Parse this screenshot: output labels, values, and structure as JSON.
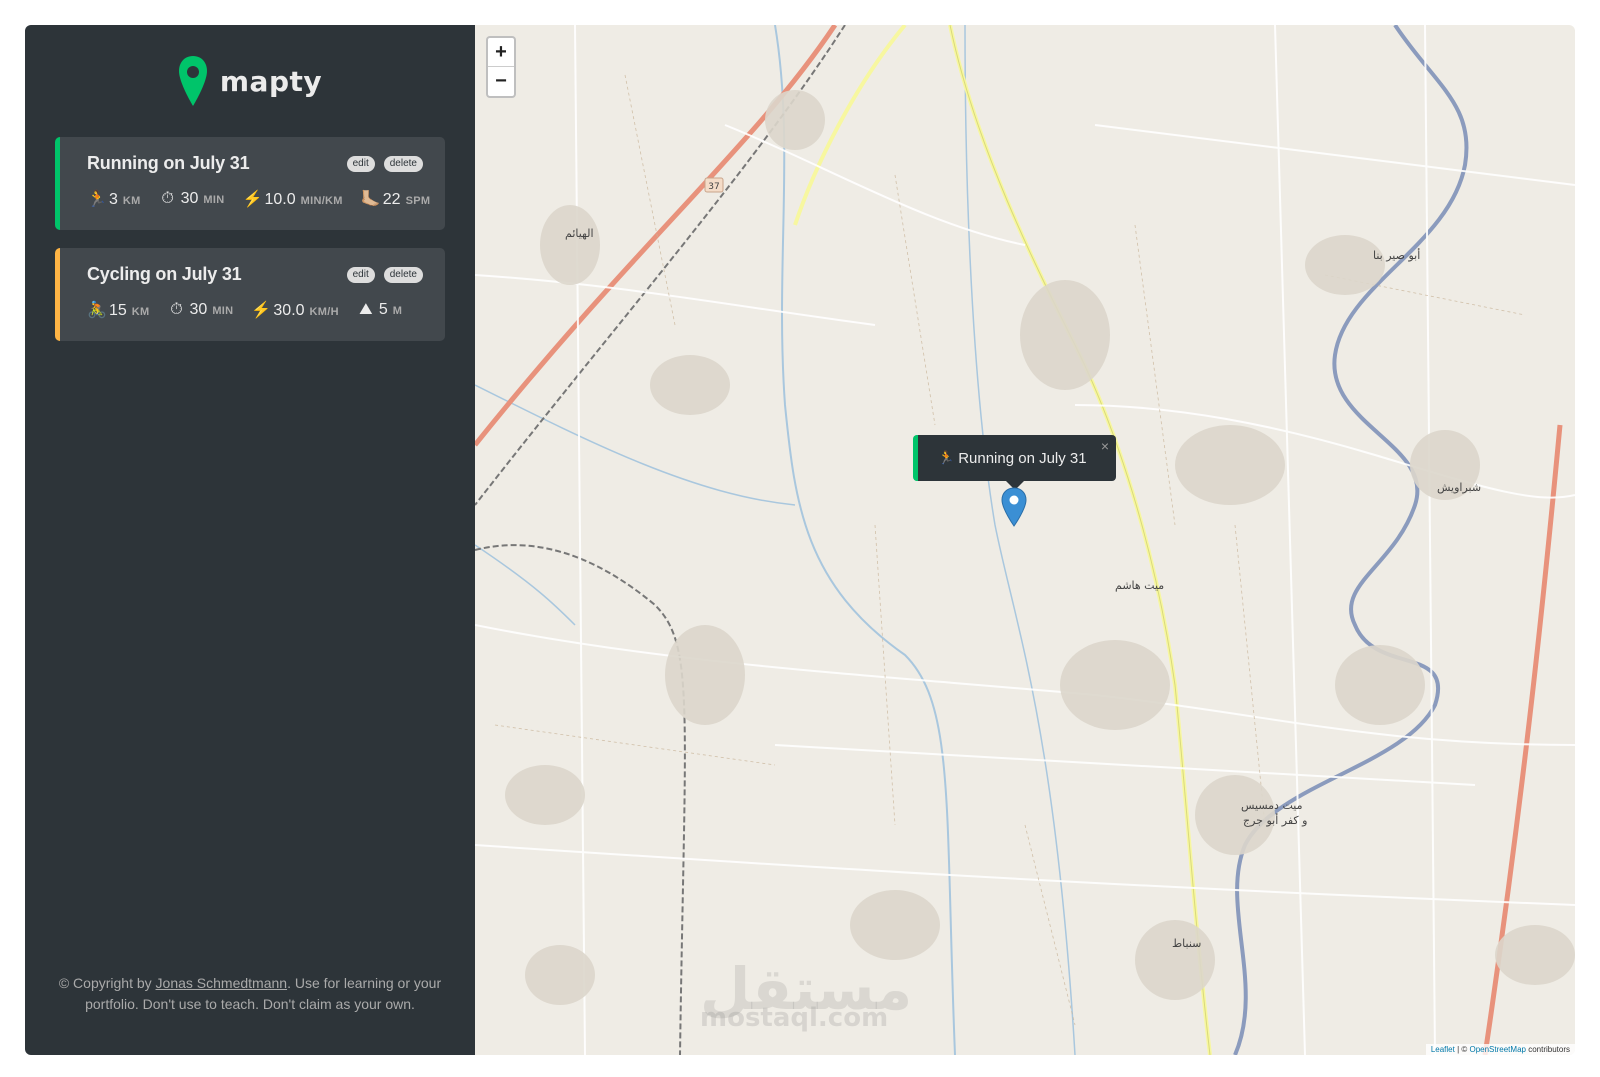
{
  "brand": {
    "name": "mapty",
    "logo_icon": "map-pin-icon",
    "color": "#00c46a"
  },
  "workouts": [
    {
      "type": "running",
      "title": "Running on July 31",
      "edit_label": "edit",
      "delete_label": "delete",
      "accent": "#00c46a",
      "stats": [
        {
          "icon": "🏃",
          "value": "3",
          "unit": "KM"
        },
        {
          "icon": "⏱",
          "value": "30",
          "unit": "MIN"
        },
        {
          "icon": "⚡️",
          "value": "10.0",
          "unit": "MIN/KM"
        },
        {
          "icon": "🦶🏼",
          "value": "22",
          "unit": "SPM"
        }
      ]
    },
    {
      "type": "cycling",
      "title": "Cycling on July 31",
      "edit_label": "edit",
      "delete_label": "delete",
      "accent": "#ffb545",
      "stats": [
        {
          "icon": "🚴",
          "value": "15",
          "unit": "KM"
        },
        {
          "icon": "⏱",
          "value": "30",
          "unit": "MIN"
        },
        {
          "icon": "⚡️",
          "value": "30.0",
          "unit": "KM/H"
        },
        {
          "icon": "⛰",
          "value": "5",
          "unit": "M"
        }
      ]
    }
  ],
  "copyright": {
    "prefix": "© Copyright by ",
    "author": "Jonas Schmedtmann",
    "suffix": ". Use for learning or your portfolio. Don't use to teach. Don't claim as your own."
  },
  "map": {
    "zoom_in": "+",
    "zoom_out": "−",
    "popup": {
      "icon": "🏃",
      "text": "Running on July 31",
      "close": "×"
    },
    "attribution": {
      "leaflet": "Leaflet",
      "separator": " | © ",
      "osm": "OpenStreetMap",
      "suffix": " contributors"
    },
    "places": [
      "الهيائم",
      "أبو صير بنا",
      "شبراويش",
      "ميت هاشم",
      "ميت دمسيس",
      "و كفر أبو جرج",
      "سنباط"
    ],
    "road_shield": "37"
  },
  "watermark": {
    "arabic": "مستقل",
    "latin": "mostaql.com"
  }
}
